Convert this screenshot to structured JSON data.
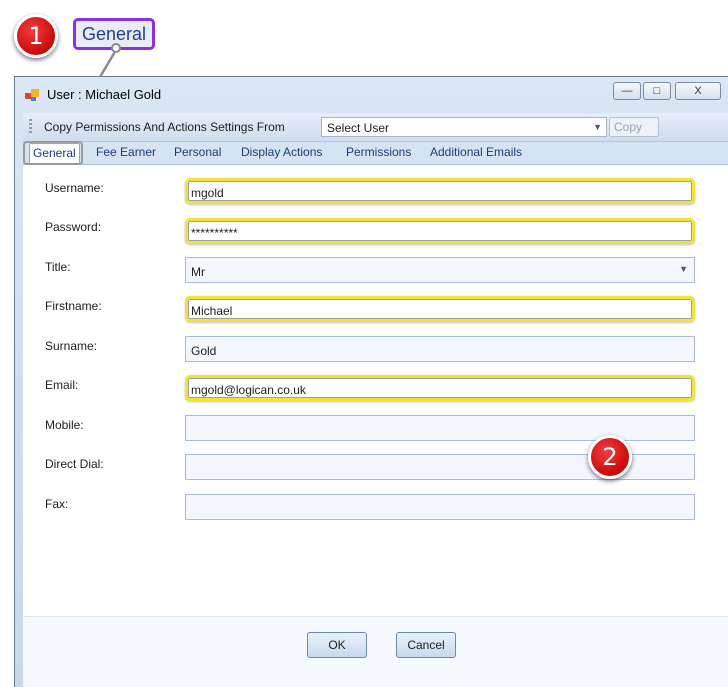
{
  "annotations": {
    "step1_number": "1",
    "step1_label": "General",
    "step2_number": "2",
    "highlight_color": "#f0e43a",
    "callout_color": "#d01010"
  },
  "window": {
    "title": "User : Michael Gold",
    "controls": {
      "minimize": "—",
      "maximize": "□",
      "close": "X"
    }
  },
  "toolbar": {
    "copy_label": "Copy Permissions And Actions Settings From",
    "select_value": "Select User",
    "copy_button": "Copy"
  },
  "tabs": [
    "General",
    "Fee Earner",
    "Personal",
    "Display Actions",
    "Permissions",
    "Additional Emails"
  ],
  "form": {
    "username": {
      "label": "Username:",
      "value": "mgold"
    },
    "password": {
      "label": "Password:",
      "value": "**********"
    },
    "title": {
      "label": "Title:",
      "value": "Mr"
    },
    "firstname": {
      "label": "Firstname:",
      "value": "Michael"
    },
    "surname": {
      "label": "Surname:",
      "value": "Gold"
    },
    "email": {
      "label": "Email:",
      "value": "mgold@logican.co.uk"
    },
    "mobile": {
      "label": "Mobile:",
      "value": ""
    },
    "direct_dial": {
      "label": "Direct Dial:",
      "value": ""
    },
    "fax": {
      "label": "Fax:",
      "value": ""
    }
  },
  "footer": {
    "ok": "OK",
    "cancel": "Cancel"
  }
}
